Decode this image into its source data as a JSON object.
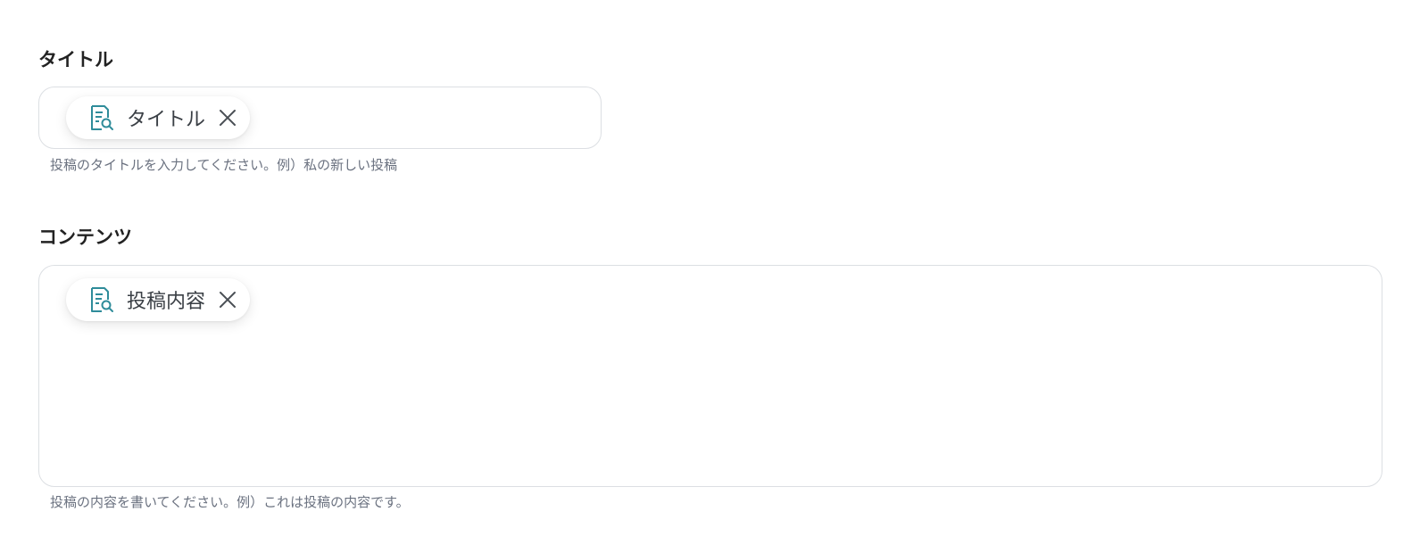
{
  "title_field": {
    "label": "タイトル",
    "chip_label": "タイトル",
    "help_text": "投稿のタイトルを入力してください。例）私の新しい投稿"
  },
  "content_field": {
    "label": "コンテンツ",
    "chip_label": "投稿内容",
    "help_text": "投稿の内容を書いてください。例）これは投稿の内容です。"
  },
  "icons": {
    "chip_icon": "document-search-icon",
    "remove_icon": "close-icon"
  },
  "colors": {
    "icon_accent": "#2f8c9a",
    "border": "#dcdfe3",
    "help_text": "#6b7280"
  }
}
